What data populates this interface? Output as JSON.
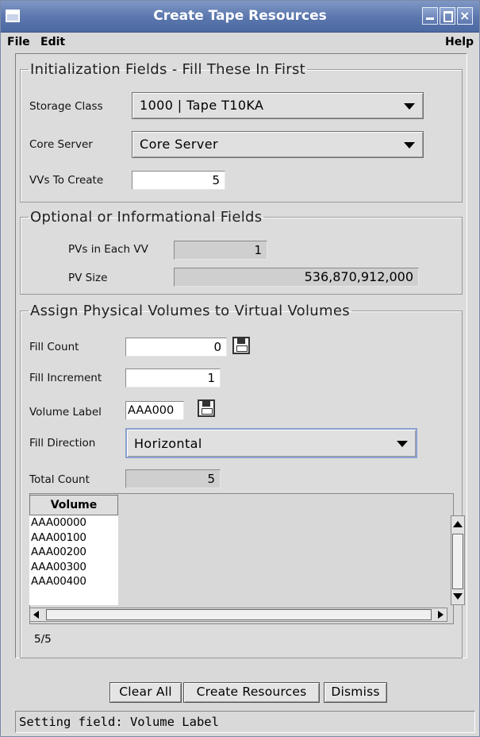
{
  "window": {
    "title": "Create Tape Resources"
  },
  "menu": {
    "file": "File",
    "edit": "Edit",
    "help": "Help"
  },
  "init_group": {
    "legend": "Initialization Fields - Fill These In First",
    "storage_class_label": "Storage Class",
    "storage_class_value": "1000 | Tape T10KA",
    "core_server_label": "Core Server",
    "core_server_value": "Core Server",
    "vvs_label": "VVs To Create",
    "vvs_value": "5"
  },
  "optional_group": {
    "legend": "Optional or Informational Fields",
    "pvs_label": "PVs in Each VV",
    "pvs_value": "1",
    "pv_size_label": "PV Size",
    "pv_size_value": "536,870,912,000"
  },
  "assign_group": {
    "legend": "Assign Physical Volumes to Virtual Volumes",
    "fill_count_label": "Fill Count",
    "fill_count_value": "0",
    "fill_increment_label": "Fill Increment",
    "fill_increment_value": "1",
    "volume_label_label": "Volume Label",
    "volume_label_value": "AAA000",
    "fill_direction_label": "Fill Direction",
    "fill_direction_value": "Horizontal",
    "total_count_label": "Total Count",
    "total_count_value": "5"
  },
  "table": {
    "column": "Volume",
    "rows": [
      "AAA00000",
      "AAA00100",
      "AAA00200",
      "AAA00300",
      "AAA00400"
    ],
    "counter": "5/5"
  },
  "buttons": {
    "clear_all": "Clear All",
    "create_resources": "Create Resources",
    "dismiss": "Dismiss"
  },
  "status": "Setting field: Volume Label",
  "colors": {
    "titlebar": "#5a76ad",
    "window_bg": "#d9d9d9"
  },
  "icons": {
    "save": "save-icon"
  }
}
